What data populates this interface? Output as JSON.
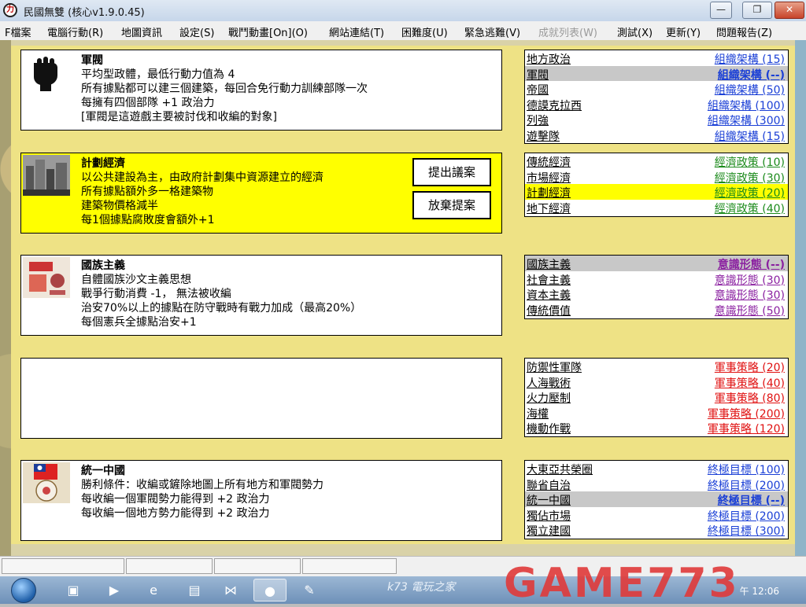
{
  "window": {
    "title": "民國無雙 (核心v1.9.0.45)",
    "app_icon_glyph": "力",
    "minimize_glyph": "—",
    "restore_glyph": "❐",
    "close_glyph": "✕"
  },
  "menu": [
    {
      "label": "F檔案",
      "enabled": true
    },
    {
      "label": "電腦行動(R)",
      "enabled": true
    },
    {
      "label": "地圖資訊",
      "enabled": true
    },
    {
      "label": "設定(S)",
      "enabled": true
    },
    {
      "label": "戰鬥動畫[On](O)",
      "enabled": true
    },
    {
      "label": "網站連結(T)",
      "enabled": true
    },
    {
      "label": "困難度(U)",
      "enabled": true
    },
    {
      "label": "緊急逃難(V)",
      "enabled": true
    },
    {
      "label": "成就列表(W)",
      "enabled": false
    },
    {
      "label": "測試(X)",
      "enabled": true
    },
    {
      "label": "更新(Y)",
      "enabled": true
    },
    {
      "label": "問題報告(Z)",
      "enabled": true
    }
  ],
  "cards": [
    {
      "title": "軍閥",
      "icon": "fist-icon",
      "lines": [
        "平均型政體，最低行動力值為 4",
        "所有據點都可以建三個建築，每回合免行動力訓練部隊一次",
        "每擁有四個部隊 +1 政治力",
        "[軍閥是這遊戲主要被討伐和收編的對象]"
      ]
    },
    {
      "title": "計劃經濟",
      "icon": "city-photo-icon",
      "lines": [
        "以公共建設為主，由政府計劃集中資源建立的經濟",
        "所有據點額外多一格建築物",
        "建築物價格減半",
        "每1個據點腐敗度會額外+1"
      ],
      "propose_label": "提出議案",
      "abandon_label": "放棄提案"
    },
    {
      "title": "國族主義",
      "icon": "poster-icon",
      "lines": [
        "自體國族沙文主義思想",
        "戰爭行動消費 -1， 無法被收編",
        "治安70%以上的據點在防守戰時有戰力加成（最高20%）",
        "每個憲兵全據點治安+1"
      ]
    },
    {
      "title": "",
      "icon": "",
      "lines": []
    },
    {
      "title": "統一中國",
      "icon": "roc-flag-icon",
      "lines": [
        "勝利條件：收編或鏟除地圖上所有地方和軍閥勢力",
        "每收編一個軍閥勢力能得到 +2 政治力",
        "每收編一個地方勢力能得到 +2 政治力"
      ]
    }
  ],
  "colors": {
    "org": "#1a3fd6",
    "econ": "#1b8a1b",
    "ideo": "#8a1fa0",
    "mil": "#e01010",
    "goal": "#1a3fd6"
  },
  "lists": [
    {
      "key": "org",
      "rows": [
        {
          "name": "地方政治",
          "tag": "組織架構 (15)",
          "state": ""
        },
        {
          "name": "軍閥",
          "tag": "組織架構 (--)",
          "state": "gray"
        },
        {
          "name": "帝國",
          "tag": "組織架構 (50)",
          "state": ""
        },
        {
          "name": "德謨克拉西",
          "tag": "組織架構 (100)",
          "state": ""
        },
        {
          "name": "列強",
          "tag": "組織架構 (300)",
          "state": ""
        },
        {
          "name": "遊擊隊",
          "tag": "組織架構 (15)",
          "state": ""
        }
      ]
    },
    {
      "key": "econ",
      "rows": [
        {
          "name": "傳統經濟",
          "tag": "經濟政策 (10)",
          "state": ""
        },
        {
          "name": "市場經濟",
          "tag": "經濟政策 (30)",
          "state": ""
        },
        {
          "name": "計劃經濟",
          "tag": "經濟政策 (20)",
          "state": "yellow"
        },
        {
          "name": "地下經濟",
          "tag": "經濟政策 (40)",
          "state": ""
        }
      ]
    },
    {
      "key": "ideo",
      "rows": [
        {
          "name": "國族主義",
          "tag": "意識形態 (--)",
          "state": "gray"
        },
        {
          "name": "社會主義",
          "tag": "意識形態 (30)",
          "state": ""
        },
        {
          "name": "資本主義",
          "tag": "意識形態 (30)",
          "state": ""
        },
        {
          "name": "傳統價值",
          "tag": "意識形態 (50)",
          "state": ""
        }
      ]
    },
    {
      "key": "mil",
      "rows": [
        {
          "name": "防禦性軍隊",
          "tag": "軍事策略 (20)",
          "state": ""
        },
        {
          "name": "人海戰術",
          "tag": "軍事策略 (40)",
          "state": ""
        },
        {
          "name": "火力壓制",
          "tag": "軍事策略 (80)",
          "state": ""
        },
        {
          "name": "海權",
          "tag": "軍事策略 (200)",
          "state": ""
        },
        {
          "name": "機動作戰",
          "tag": "軍事策略 (120)",
          "state": ""
        }
      ]
    },
    {
      "key": "goal",
      "rows": [
        {
          "name": "大東亞共榮圈",
          "tag": "終極目標 (100)",
          "state": ""
        },
        {
          "name": "聯省自治",
          "tag": "終極目標 (200)",
          "state": ""
        },
        {
          "name": "統一中國",
          "tag": "終極目標 (--)",
          "state": "gray"
        },
        {
          "name": "獨佔市場",
          "tag": "終極目標 (200)",
          "state": ""
        },
        {
          "name": "獨立建國",
          "tag": "終極目標 (300)",
          "state": ""
        }
      ]
    }
  ],
  "taskbar": {
    "items": [
      "folder-icon",
      "media-player-icon",
      "ie-icon",
      "explorer-icon",
      "bowtie-app-icon",
      "game-icon",
      "paint-icon"
    ],
    "watermark_small": "k73 電玩之家",
    "watermark_big": "GAME773",
    "clock": "午 12:06"
  }
}
